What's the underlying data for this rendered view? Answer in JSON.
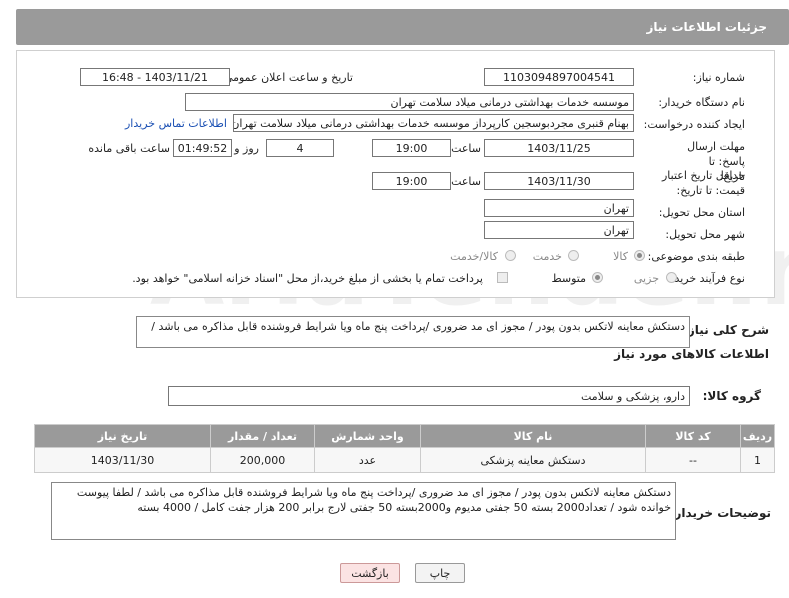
{
  "header": {
    "title": "جزئیات اطلاعات نیاز"
  },
  "form": {
    "need_number": {
      "label": "شماره نیاز:",
      "value": "1103094897004541"
    },
    "announce_datetime": {
      "label": "تاریخ و ساعت اعلان عمومی:",
      "value": "1403/11/21 - 16:48"
    },
    "buyer_org": {
      "label": "نام دستگاه خریدار:",
      "value": "موسسه خدمات بهداشتی درمانی میلاد سلامت تهران"
    },
    "requester": {
      "label": "ایجاد کننده درخواست:",
      "value": "بهنام قنبری مجردبوسجین کارپرداز موسسه خدمات بهداشتی درمانی میلاد سلامت تهران",
      "contact_link": "اطلاعات تماس خریدار"
    },
    "deadline": {
      "label": "مهلت ارسال پاسخ: تا تاریخ:",
      "date": "1403/11/25",
      "time_label": "ساعت",
      "time": "19:00",
      "days": "4",
      "days_label": "روز و",
      "remaining": "01:49:52",
      "remaining_label": "ساعت باقی مانده"
    },
    "price_validity": {
      "label": "حداقل تاریخ اعتبار قیمت: تا تاریخ:",
      "date": "1403/11/30",
      "time_label": "ساعت",
      "time": "19:00"
    },
    "province": {
      "label": "استان محل تحویل:",
      "value": "تهران"
    },
    "city": {
      "label": "شهر محل تحویل:",
      "value": "تهران"
    },
    "category": {
      "label": "طبقه بندی موضوعی:",
      "options": [
        "کالا",
        "خدمت",
        "کالا/خدمت"
      ],
      "selected": "کالا"
    },
    "process": {
      "label": "نوع فرآیند خرید :",
      "options": [
        "جزیی",
        "متوسط"
      ],
      "selected": "متوسط",
      "payment_note": "پرداخت تمام یا بخشی از مبلغ خرید،از محل \"اسناد خزانه اسلامی\" خواهد بود."
    }
  },
  "description": {
    "label": "شرح کلی نیاز:",
    "text": "دستکش معاینه لاتکس  بدون پودر / مجوز ای مد ضروری /پرداخت پنج ماه ویا شرایط فروشنده  قابل مذاکره می باشد  /"
  },
  "goods_info": {
    "title": "اطلاعات کالاهای مورد نیاز",
    "group_label": "گروه کالا:",
    "group_value": "دارو، پزشکی و سلامت"
  },
  "table": {
    "headers": [
      "ردیف",
      "کد کالا",
      "نام کالا",
      "واحد شمارش",
      "تعداد / مقدار",
      "تاریخ نیاز"
    ],
    "rows": [
      [
        "1",
        "--",
        "دستکش معاینه پزشکی",
        "عدد",
        "200,000",
        "1403/11/30"
      ]
    ]
  },
  "buyer_notes": {
    "label": "توضیحات خریدار:",
    "text": "دستکش معاینه لاتکس  بدون پودر / مجوز ای مد ضروری /پرداخت پنج ماه ویا شرایط فروشنده  قابل مذاکره می باشد  /  لطفا پیوست خوانده شود  / تعداد2000 بسته 50 جفتی مدیوم و2000بسته 50 جفتی لارج  برابر 200 هزار جفت کامل /  4000 بسته"
  },
  "buttons": {
    "print": "چاپ",
    "back": "بازگشت"
  },
  "colors": {
    "header_bg": "#9a9a9a",
    "link": "#1a4fb3",
    "back_button_bg": "#fbe3e3"
  }
}
